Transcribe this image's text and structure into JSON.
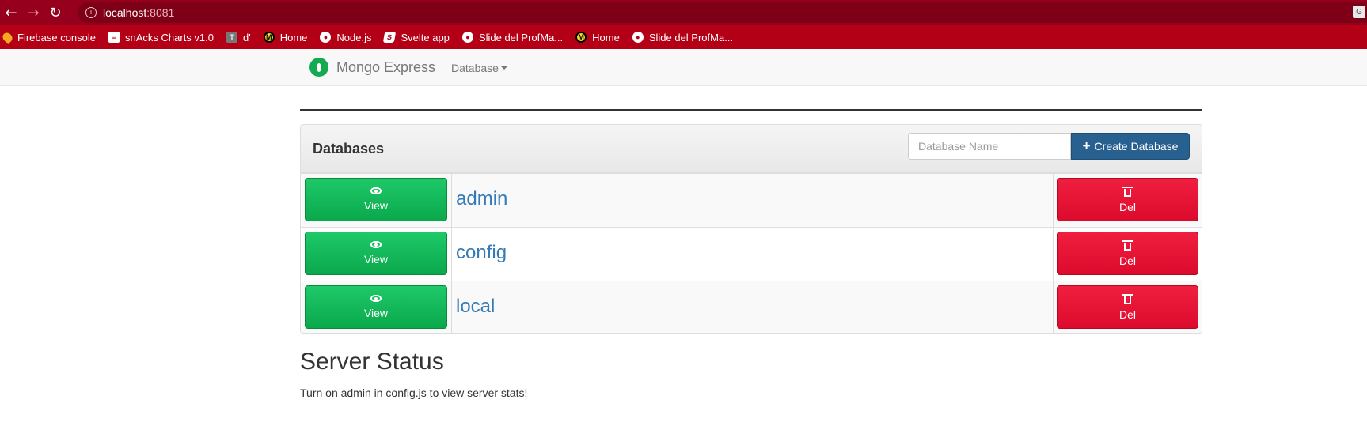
{
  "browser": {
    "url_host": "localhost",
    "url_port": ":8081",
    "bookmarks": [
      {
        "label": "Firebase console",
        "icon": "firebase-icon"
      },
      {
        "label": "snAcks Charts v1.0",
        "icon": "snacks-icon"
      },
      {
        "label": "d'",
        "icon": "t-icon"
      },
      {
        "label": "Home",
        "icon": "m-icon"
      },
      {
        "label": "Node.js",
        "icon": "globe-icon"
      },
      {
        "label": "Svelte app",
        "icon": "svelte-icon"
      },
      {
        "label": "Slide del ProfMa...",
        "icon": "globe-icon"
      },
      {
        "label": "Home",
        "icon": "m-icon"
      },
      {
        "label": "Slide del ProfMa...",
        "icon": "globe-icon"
      }
    ]
  },
  "navbar": {
    "brand": "Mongo Express",
    "database_menu": "Database"
  },
  "databases": {
    "title": "Databases",
    "input_placeholder": "Database Name",
    "create_label": "Create Database",
    "view_label": "View",
    "del_label": "Del",
    "rows": [
      {
        "name": "admin"
      },
      {
        "name": "config"
      },
      {
        "name": "local"
      }
    ]
  },
  "server_status": {
    "title": "Server Status",
    "message": "Turn on admin in config.js to view server stats!"
  },
  "colors": {
    "browser_frame": "#96001c",
    "bookmarks_bar": "#b40016",
    "view_button": "#0aa84c",
    "del_button": "#dc0a2c",
    "create_button": "#286090",
    "link": "#337ab7"
  }
}
